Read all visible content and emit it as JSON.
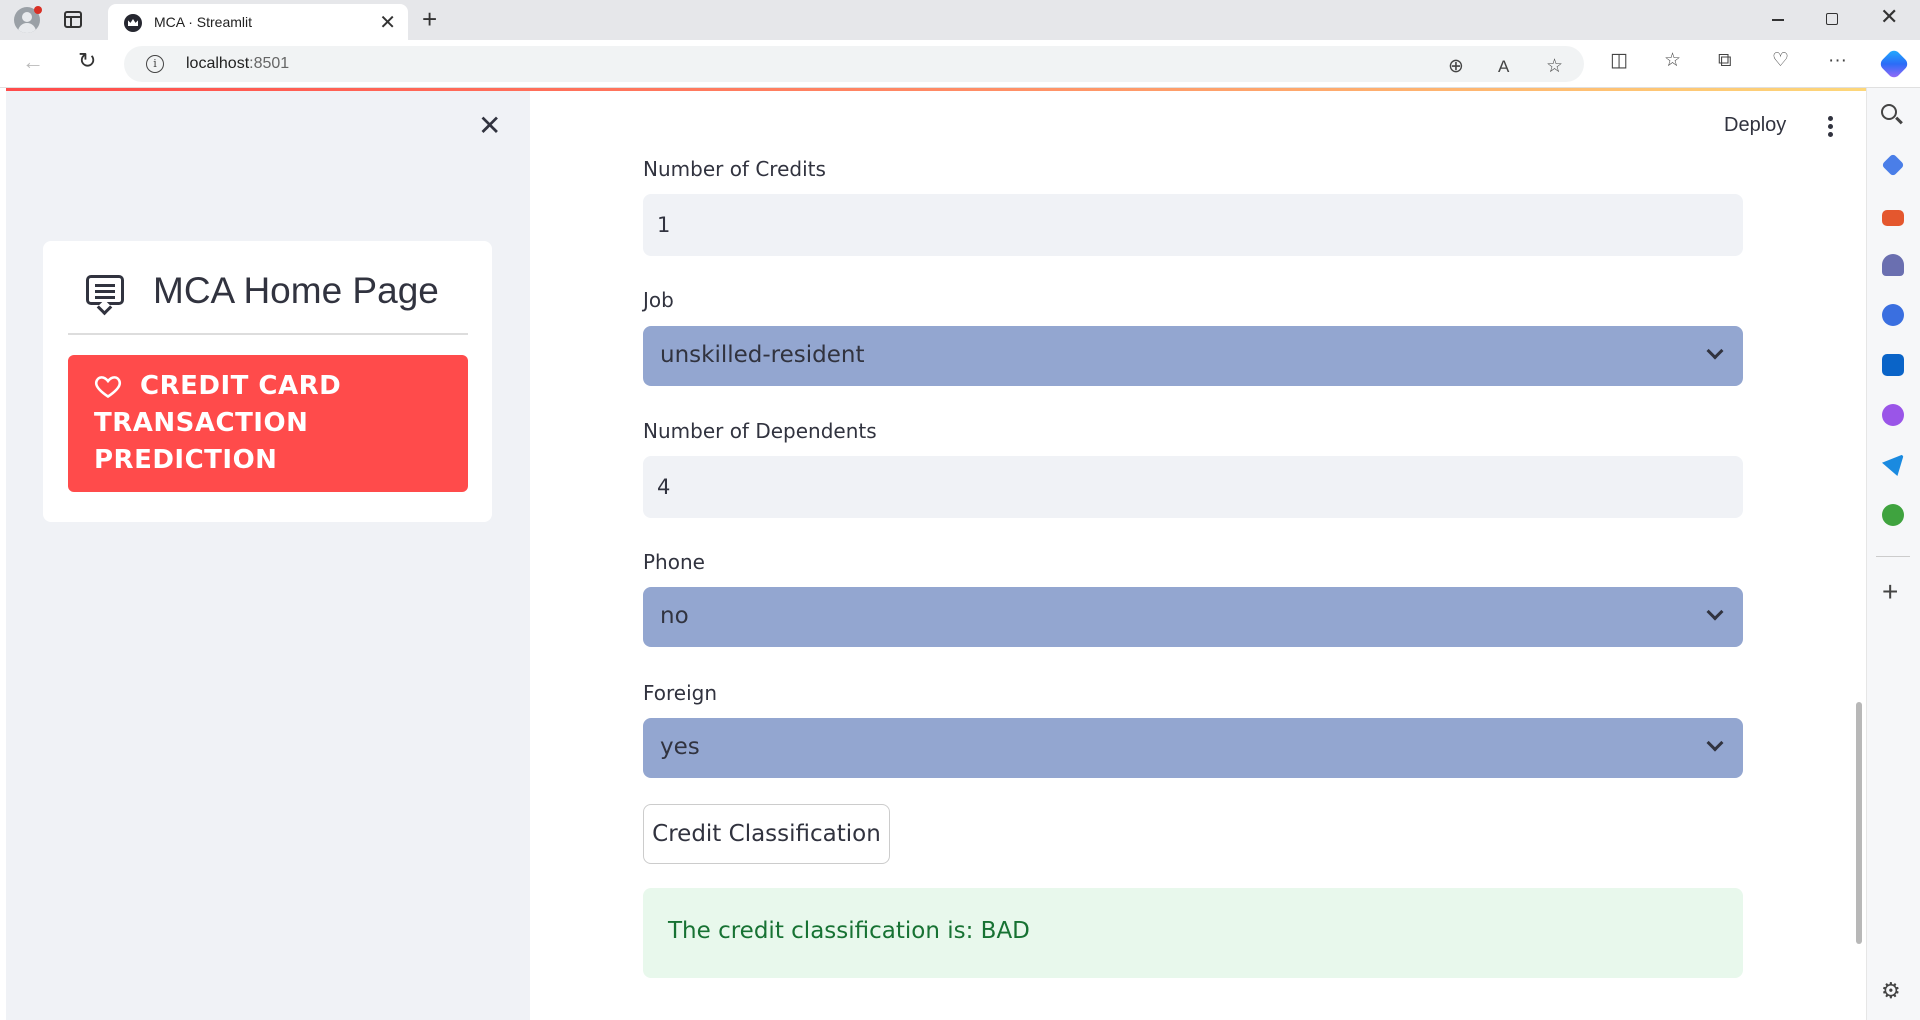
{
  "browser": {
    "tab_title": "MCA · Streamlit",
    "url_host": "localhost",
    "url_port": ":8501"
  },
  "header": {
    "deploy_label": "Deploy"
  },
  "sidebar": {
    "close_icon": "close-icon",
    "title": "MCA Home Page",
    "menu_items": [
      {
        "label": "Credit Card Transaction Prediction",
        "icon": "heart-icon",
        "selected": true
      }
    ],
    "selected_color": "#ff4b4b"
  },
  "form": {
    "credits": {
      "label": "Number of Credits",
      "value": "1"
    },
    "job": {
      "label": "Job",
      "value": "unskilled-resident"
    },
    "dependents": {
      "label": "Number of Dependents",
      "value": "4"
    },
    "phone": {
      "label": "Phone",
      "value": "no"
    },
    "foreign": {
      "label": "Foreign",
      "value": "yes"
    },
    "submit_label": "Credit Classification"
  },
  "result": {
    "message": "The credit classification is: BAD",
    "color": "#177233"
  },
  "colors": {
    "accent": "#ff4b4b",
    "select_bg": "#93a6d0",
    "input_bg": "#f0f2f6",
    "success_bg": "#e8f8ec"
  }
}
